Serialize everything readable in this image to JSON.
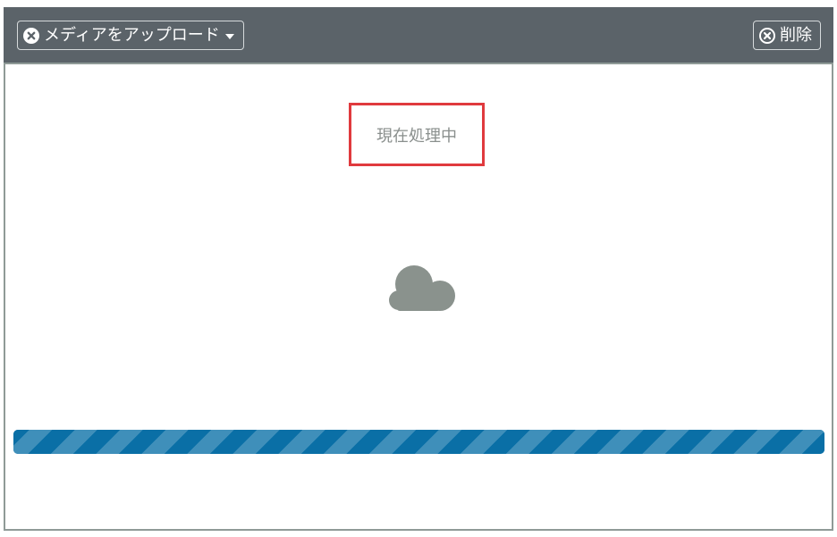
{
  "toolbar": {
    "upload_label": "メディアをアップロード",
    "delete_label": "削除",
    "icons": {
      "upload": "close-circle-icon",
      "dropdown": "caret-down-icon",
      "delete": "close-circle-icon"
    }
  },
  "status": {
    "text": "現在処理中"
  },
  "upload_area": {
    "icon": "cloud-icon"
  },
  "progress": {
    "value_fraction": 1.0,
    "style": "striped"
  },
  "colors": {
    "toolbar_bg": "#5b6369",
    "highlight_border": "#e03a3e",
    "progress_primary": "#0a6fa6",
    "progress_stripe": "#3f8fba",
    "cloud": "#8a928d",
    "status_text": "#8a8f8d"
  }
}
